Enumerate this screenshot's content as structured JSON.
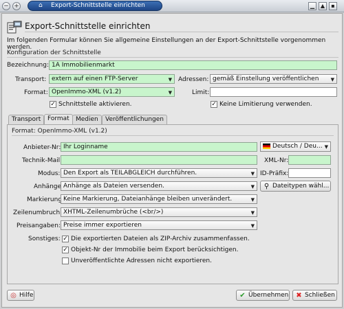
{
  "window": {
    "title": "Export-Schnittstelle einrichten"
  },
  "header": {
    "title": "Export-Schnittstelle einrichten",
    "description": "Im folgenden Formular können Sie allgemeine Einstellungen an der Export-Schnittstelle vorgenommen werden."
  },
  "config": {
    "section_title": "Konfiguration der Schnittstelle",
    "bezeichnung_label": "Bezeichnung:",
    "bezeichnung_value": "1A Immobilienmarkt",
    "transport_label": "Transport:",
    "transport_value": "extern auf einen FTP-Server",
    "adressen_label": "Adressen:",
    "adressen_value": "gemäß Einstellung veröffentlichen",
    "format_label": "Format:",
    "format_value": "OpenImmo-XML (v1.2)",
    "limit_label": "Limit:",
    "limit_value": "",
    "aktivieren_label": "Schnittstelle aktivieren.",
    "aktivieren_checked": true,
    "keine_limit_label": "Keine Limitierung verwenden.",
    "keine_limit_checked": true
  },
  "tabs": [
    {
      "label": "Transport",
      "active": false
    },
    {
      "label": "Format",
      "active": true
    },
    {
      "label": "Medien",
      "active": false
    },
    {
      "label": "Veröffentlichungen",
      "active": false
    }
  ],
  "format_tab": {
    "section_title": "Format: OpenImmo-XML (v1.2)",
    "anbieter_label": "Anbieter-Nr:",
    "anbieter_value": "Ihr Loginname",
    "language_value": "Deutsch / Deu...",
    "technik_label": "Technik-Mail:",
    "technik_value": "",
    "xml_nr_label": "XML-Nr:",
    "xml_nr_value": "",
    "modus_label": "Modus:",
    "modus_value": "Den Export als TEILABGLEICH durchführen.",
    "id_praefix_label": "ID-Präfix:",
    "id_praefix_value": "",
    "anhaenge_label": "Anhänge:",
    "anhaenge_value": "Anhänge als Dateien versenden.",
    "dateitypen_label": "Dateitypen wähl...",
    "markierung_label": "Markierung:",
    "markierung_value": "Keine Markierung, Dateianhänge bleiben unverändert.",
    "zeilenumbruch_label": "Zeilenumbruch:",
    "zeilenumbruch_value": "XHTML-Zeilenumbrüche (<br/>)",
    "preisangaben_label": "Preisangaben:",
    "preisangaben_value": "Preise immer exportieren",
    "sonstiges_label": "Sonstiges:",
    "options": [
      {
        "label": "Die exportierten Dateien als ZIP-Archiv zusammenfassen.",
        "checked": true
      },
      {
        "label": "Objekt-Nr der Immobilie beim Export berücksichtigen.",
        "checked": true
      },
      {
        "label": "Unveröffentlichte Adressen nicht exportieren.",
        "checked": false
      }
    ]
  },
  "footer": {
    "help_label": "Hilfe",
    "accept_label": "Übernehmen",
    "close_label": "Schließen"
  },
  "colors": {
    "required_field": "#c8f5cc",
    "titlebar_accent": "#2a5aa0"
  }
}
